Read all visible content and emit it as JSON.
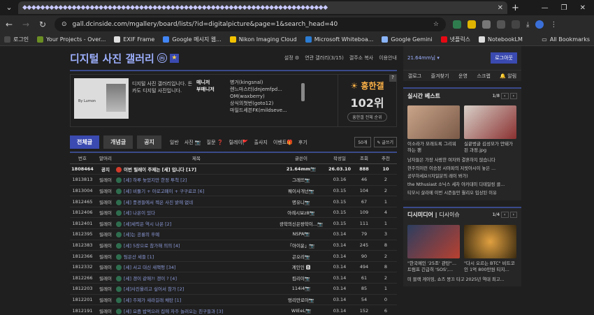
{
  "browser": {
    "tab_title": "◆◆◆◆◆◆◆◆◆◆◆◆◆◆◆◆◆◆◆◆◆◆◆◆◆◆◆◆◆◆◆◆◆◆◆◆◆◆◆◆◆◆◆◆◆◆◆◆◆◆◆◆◆◆◆◆◆◆◆◆◆◆◆◆◆◆◆◆",
    "url": "gall.dcinside.com/mgallery/board/lists/?id=digitalpicture&page=1&search_head=40",
    "bookmarks": [
      {
        "label": "로그인",
        "color": "#4a4a4a"
      },
      {
        "label": "Your Projects - Over...",
        "color": "#6b8e23"
      },
      {
        "label": "EXIF Frame",
        "color": "#e0e0e0"
      },
      {
        "label": "Google 메시지 웹...",
        "color": "#4285f4"
      },
      {
        "label": "Nikon Imaging Cloud",
        "color": "#f2c200"
      },
      {
        "label": "Microsoft Whiteboa...",
        "color": "#2b7cd3"
      },
      {
        "label": "Google Gemini",
        "color": "#8ab4f8"
      },
      {
        "label": "넷플릭스",
        "color": "#e50914"
      },
      {
        "label": "NotebookLM",
        "color": "#ddd"
      }
    ],
    "all_bookmarks": "All Bookmarks"
  },
  "gallery": {
    "title": "디지털 사진 갤러리",
    "badge": "ⓜ",
    "menu": [
      "설정 ⚙",
      "연관 갤러리(3/15)",
      "갤주소 복사",
      "이용안내"
    ],
    "description": "디지털 사진 갤러리입니다. 돈카도 디지털 사진입니다.",
    "managers": {
      "k1": "매니저",
      "v1": "병거(kingsnal)",
      "k2": "부매니저",
      "v2": [
        "렌느마스터(dnjemfpd...",
        "OM(waxberry)",
        "상식의첫번(goto12)",
        "마일드세븐FK(mildseve..."
      ]
    },
    "rank": {
      "label": "흥한갤",
      "value": "102위",
      "button": "흥한갤 전체 순위",
      "help": "?"
    },
    "thumb_caption": "By Lumon",
    "tabs": [
      "전체글",
      "개념글",
      "공지"
    ],
    "heads": [
      "일반",
      "사진 📷",
      "질문 ❓",
      "릴레이🚩",
      "출사지",
      "이벤트🎁",
      "후기"
    ],
    "per_page": "50개",
    "write": "✎ 글쓰기",
    "columns": [
      "번호",
      "말머리",
      "제목",
      "글쓴이",
      "작성일",
      "조회",
      "추천"
    ],
    "rows": [
      {
        "no": "1808464",
        "head": "공지",
        "title": "이번 릴레이 주제는 [세] 입니다 [17]",
        "writer": "21.64mm📷",
        "date": "26.03.10",
        "views": "888",
        "rec": "10",
        "notice": true
      },
      {
        "no": "1813813",
        "head": "릴레이",
        "title": "[세] 하루 늦었지만 한정 투척 [2]",
        "writer": "그레뜨📷",
        "date": "03.16",
        "views": "46",
        "rec": "2"
      },
      {
        "no": "1813004",
        "head": "릴레이",
        "title": "[세] 비둘기 + 아로고페이 + 구구료코 [6]",
        "writer": "꿰이사개넌📷",
        "date": "03.15",
        "views": "104",
        "rec": "2"
      },
      {
        "no": "1812465",
        "head": "릴레이",
        "title": "[세] 풍경들에서 젝은 사진 밝에 없네",
        "writer": "명유니📷",
        "date": "03.15",
        "views": "67",
        "rec": "1"
      },
      {
        "no": "1812406",
        "head": "릴레이",
        "title": "[세] 나온이 있다",
        "writer": "아례시보z8📷",
        "date": "03.15",
        "views": "109",
        "rec": "4"
      },
      {
        "no": "1812401",
        "head": "릴레이",
        "title": "[세]세력은 역시 나온 [2]",
        "writer": "광학의신은왕학이...📷",
        "date": "03.15",
        "views": "111",
        "rec": "1"
      },
      {
        "no": "1812395",
        "head": "릴레이",
        "title": "[세]는 공룡의 후예",
        "writer": "NSPA📷",
        "date": "03.14",
        "views": "79",
        "rec": "3"
      },
      {
        "no": "1812383",
        "head": "릴레이",
        "title": "[세] 5장으로 참가해 의의 [4]",
        "writer": "「아이윤」📷",
        "date": "03.14",
        "views": "245",
        "rec": "8"
      },
      {
        "no": "1812366",
        "head": "릴레이",
        "title": "팀은산 세들 [1]",
        "writer": "곤오리📷",
        "date": "03.14",
        "views": "90",
        "rec": "2"
      },
      {
        "no": "1812332",
        "head": "릴레이",
        "title": "[세] 서고 대신 새책펑 [34]",
        "writer": "계인인 🅱",
        "date": "03.14",
        "views": "494",
        "rec": "8"
      },
      {
        "no": "1812266",
        "head": "릴레이",
        "title": "[세] 갱이 같애?! 갱이 ? [4]",
        "writer": "킴리이📷",
        "date": "03.14",
        "views": "61",
        "rec": "2"
      },
      {
        "no": "1812203",
        "head": "릴레이",
        "title": "[세]사진올리고 싶어서 참가 [2]",
        "writer": "114i4📷",
        "date": "03.14",
        "views": "85",
        "rec": "1"
      },
      {
        "no": "1812201",
        "head": "릴레이",
        "title": "[세] 주제가 새라길래 채탄 [1]",
        "writer": "멍리만로아📷",
        "date": "03.14",
        "views": "54",
        "rec": "0"
      },
      {
        "no": "1812191",
        "head": "릴레이",
        "title": "[세] 요즘 밥먹으러 집에 자주 놀러오는 친구들과 [3]",
        "writer": "WIEeL📷",
        "date": "03.14",
        "views": "152",
        "rec": "6"
      }
    ]
  },
  "sidebar": {
    "account": "21.64mm님 ▾",
    "login_btn": "로그아웃",
    "quick": [
      "갤로그",
      "즐겨찾기",
      "운영",
      "스크랩",
      "🔔 알림"
    ],
    "best": {
      "title": "실시간 베스트",
      "page": "1/8",
      "cards": [
        {
          "text": "이소라가 모래도록 그리워하는 팬"
        },
        {
          "text": "실끝벙글 김성모가 안돼가 된 과정.jpg"
        }
      ],
      "list": [
        "남자들은 가장 사랑한 여자와 결혼하지 않습니다",
        "현주의이런 이승정 시아파의 저릿아시이 놓은 ...",
        "공부하세요!(자일분의 레이 봐가)",
        "the Nthusiast 소닉스 세차 야카대미 디테일링 클...",
        "티모시 살라메 이번 시즌들만 월리오 입상된 이유"
      ]
    },
    "dis": {
      "title_a": "디시미디어",
      "title_b": "디시이슈",
      "page": "1/4",
      "cards": [
        {
          "text": "\"한국메인 '25조' 관탄\"... 트럼프 긴급히 'SOS',..."
        },
        {
          "text": "\"다시 오르는 BTC\" 비트코인 1억 800만원 티지..."
        }
      ],
      "list": [
        "미 블랙 게이밍, 쇼즈 몽끄 타고 2025년 역대 최고..."
      ]
    }
  }
}
